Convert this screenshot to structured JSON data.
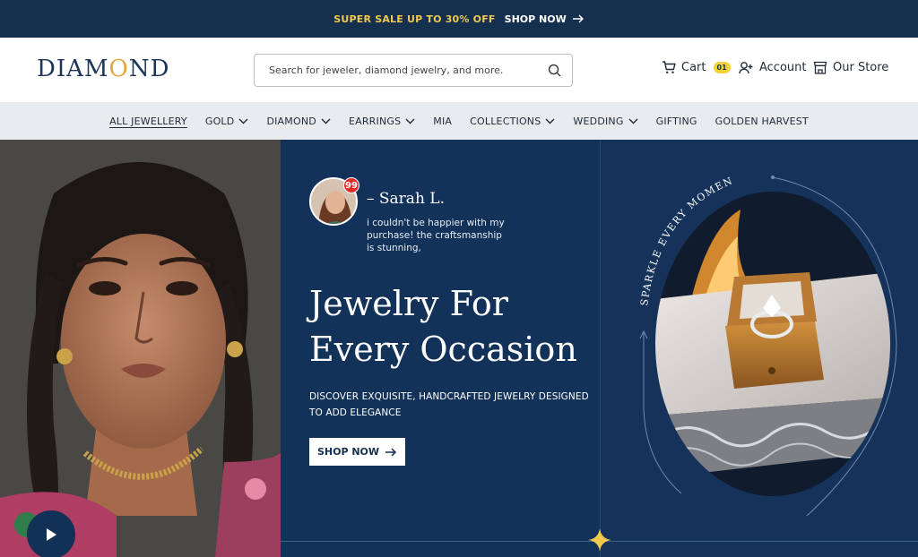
{
  "topbar": {
    "sale_text": "SUPER SALE UP TO 30% OFF",
    "shop_label": "SHOP NOW"
  },
  "header": {
    "logo_prefix": "DIAM",
    "logo_ring": "O",
    "logo_suffix": "ND",
    "search_placeholder": "Search for jeweler, diamond jewelry, and more.",
    "cart_label": "Cart",
    "cart_count": "01",
    "account_label": "Account",
    "store_label": "Our Store"
  },
  "nav": {
    "items": [
      {
        "label": "ALL JEWELLERY",
        "has_dropdown": false,
        "active": true
      },
      {
        "label": "GOLD",
        "has_dropdown": true
      },
      {
        "label": "DIAMOND",
        "has_dropdown": true
      },
      {
        "label": "EARRINGS",
        "has_dropdown": true
      },
      {
        "label": "MIA",
        "has_dropdown": false
      },
      {
        "label": "COLLECTIONS",
        "has_dropdown": true
      },
      {
        "label": "WEDDING",
        "has_dropdown": true
      },
      {
        "label": "GIFTING",
        "has_dropdown": false
      },
      {
        "label": "GOLDEN HARVEST",
        "has_dropdown": false
      }
    ]
  },
  "hero": {
    "testimonial_name": "– Sarah L.",
    "testimonial_badge": "99",
    "testimonial_quote": "i couldn't be happier with my purchase! the craftsmanship is stunning,",
    "headline_line1": "Jewelry For",
    "headline_line2": "Every Occasion",
    "subheadline": "DISCOVER EXQUISITE, HANDCRAFTED JEWELRY DESIGNED TO ADD ELEGANCE",
    "cta_label": "SHOP NOW",
    "curved_text": "SPARKLE EVERY MOMENT"
  },
  "colors": {
    "navy": "#133259",
    "topbar": "#15304f",
    "gold": "#f2c94c",
    "nav_bg": "#e8ecef",
    "badge": "#f2d13a",
    "quote_red": "#e22b2b"
  },
  "icons": {
    "arrow": "arrow-right-icon",
    "search": "search-icon",
    "cart": "cart-icon",
    "account": "user-plus-icon",
    "store": "store-icon",
    "chevron": "chevron-down-icon",
    "play": "play-icon",
    "star": "sparkle-star-icon"
  }
}
